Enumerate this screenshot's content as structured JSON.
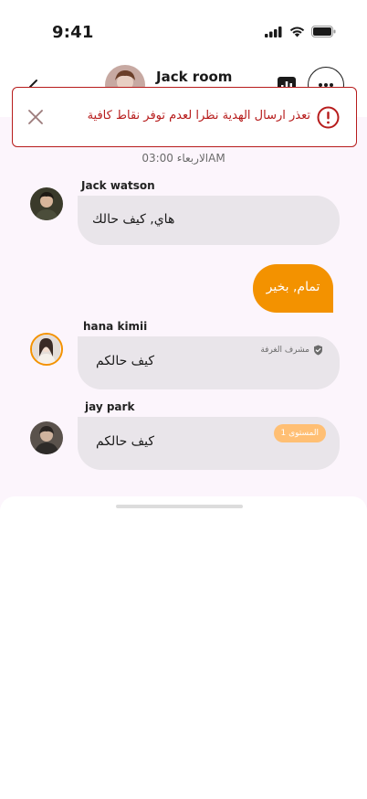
{
  "status_bar": {
    "time": "9:41",
    "icons": [
      "signal-icon",
      "wifi-icon",
      "battery-icon"
    ]
  },
  "header": {
    "title": "Jack room",
    "icons": [
      "back-icon",
      "chart-icon",
      "more-icon"
    ]
  },
  "alert": {
    "text": "تعذر ارسال الهدية نظرا لعدم توفر نقاط كافية",
    "color": "#b71c1c"
  },
  "date_separator": "الاربعاء 03:00AM",
  "messages": [
    {
      "sender": "Jack watson",
      "text": "هاي, كيف حالك"
    },
    {
      "text": "تمام, بخير",
      "outgoing": true
    },
    {
      "sender": "hana kimii",
      "text": "كيف حالكم",
      "badge": "مشرف الغرفة"
    },
    {
      "sender": "jay park",
      "text": "كيف حالكم",
      "badge": "المستوى 1"
    }
  ],
  "colors": {
    "accent": "#f39200",
    "level_badge": "#ffbf74",
    "chat_bg": "#fcf5fc",
    "incoming_bubble": "#e9e5ea"
  }
}
